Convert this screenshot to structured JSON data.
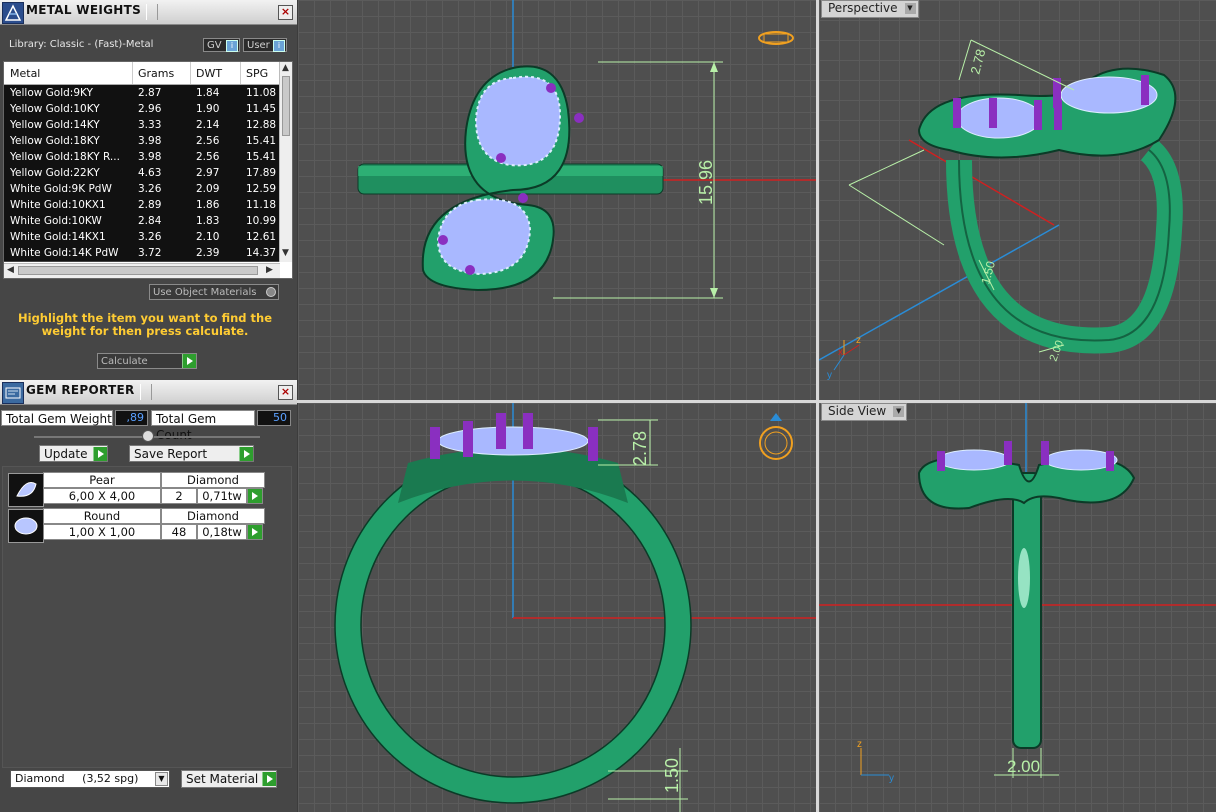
{
  "metal_panel": {
    "title": "METAL WEIGHTS",
    "library_label": "Library: Classic - (Fast)-Metal",
    "gv_label": "GV",
    "user_label": "User",
    "columns": [
      "Metal",
      "Grams",
      "DWT",
      "SPG"
    ],
    "rows": [
      [
        "Yellow Gold:9KY",
        "2.87",
        "1.84",
        "11.08"
      ],
      [
        "Yellow Gold:10KY",
        "2.96",
        "1.90",
        "11.45"
      ],
      [
        "Yellow Gold:14KY",
        "3.33",
        "2.14",
        "12.88"
      ],
      [
        "Yellow Gold:18KY",
        "3.98",
        "2.56",
        "15.41"
      ],
      [
        "Yellow Gold:18KY R...",
        "3.98",
        "2.56",
        "15.41"
      ],
      [
        "Yellow Gold:22KY",
        "4.63",
        "2.97",
        "17.89"
      ],
      [
        "White Gold:9K PdW",
        "3.26",
        "2.09",
        "12.59"
      ],
      [
        "White Gold:10KX1",
        "2.89",
        "1.86",
        "11.18"
      ],
      [
        "White Gold:10KW",
        "2.84",
        "1.83",
        "10.99"
      ],
      [
        "White Gold:14KX1",
        "3.26",
        "2.10",
        "12.61"
      ],
      [
        "White Gold:14K PdW",
        "3.72",
        "2.39",
        "14.37"
      ]
    ],
    "use_object_materials": "Use Object Materials",
    "hint": "Highlight the item you want to find the weight for then press calculate.",
    "calculate": "Calculate"
  },
  "gem_panel": {
    "title": "GEM REPORTER",
    "total_weight_label": "Total Gem Weight",
    "total_weight_value": ",89",
    "total_count_label": "Total Gem Count",
    "total_count_value": "50",
    "update": "Update",
    "save_report": "Save Report",
    "gems": [
      {
        "shape": "Pear",
        "type": "Diamond",
        "size": "6,00 X 4,00",
        "count": "2",
        "weight": "0,71tw"
      },
      {
        "shape": "Round",
        "type": "Diamond",
        "size": "1,00 X 1,00",
        "count": "48",
        "weight": "0,18tw"
      }
    ],
    "material_select": "Diamond     (3,52 spg)",
    "set_material": "Set Material"
  },
  "viewports": {
    "top": {
      "dimension": "15.96"
    },
    "perspective": {
      "label": "Perspective",
      "dim_a": "2.78",
      "dim_b": "1.50",
      "dim_c": "2.00",
      "axis_x": "x",
      "axis_z": "z",
      "axis_y": "y"
    },
    "front": {
      "dim_top": "2.78",
      "dim_bottom": "1.50"
    },
    "side": {
      "label": "Side View",
      "dim_bottom": "2.00",
      "axis_z": "z",
      "axis_y": "y"
    }
  },
  "colors": {
    "ring": "#22a06b",
    "gem": "#a9b8ff",
    "prong": "#8a2fc0",
    "axis_red": "#d02020",
    "axis_blue": "#2a8cd6",
    "dim_line": "#b8f0a8"
  }
}
